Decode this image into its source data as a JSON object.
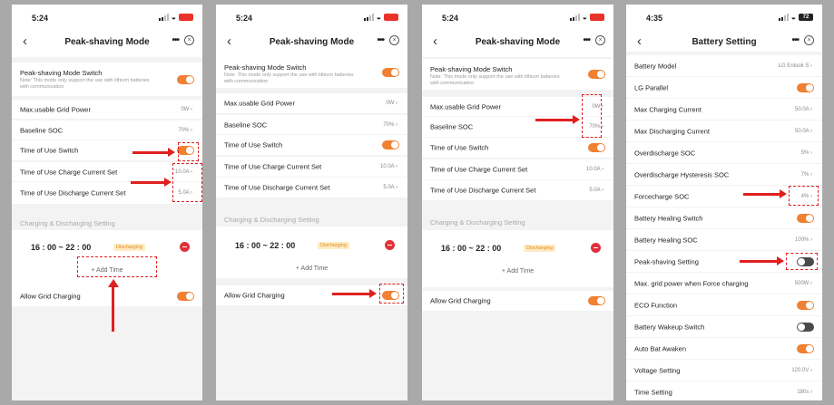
{
  "screens": [
    {
      "time": "5:24",
      "battery": "",
      "battery_color": "#e8322a",
      "title": "Peak-shaving Mode",
      "switch_label": "Peak-shaving Mode Switch",
      "switch_note": "Note: This mode only support the use with lithium batteries with communication",
      "rows": [
        {
          "label": "Max.usable Grid Power",
          "value": "0W"
        },
        {
          "label": "Baseline SOC",
          "value": "70%"
        },
        {
          "label": "Time of Use Switch",
          "value": ""
        },
        {
          "label": "Time of Use Charge Current Set",
          "value": "10.0A"
        },
        {
          "label": "Time of Use Discharge Current Set",
          "value": "5.0A"
        }
      ],
      "section": "Charging & Discharging Setting",
      "time_range": "16 : 00 ~ 22 : 00",
      "tag": "Discharging",
      "add_time": "+ Add Time",
      "allow_grid": "Allow Grid Charging"
    },
    {
      "time": "5:24",
      "battery": "",
      "battery_color": "#e8322a",
      "title": "Peak-shaving Mode",
      "switch_label": "Peak-shaving Mode Switch",
      "switch_note": "Note: This mode only support the use with lithium batteries with communication",
      "rows": [
        {
          "label": "Max.usable Grid Power",
          "value": "0W"
        },
        {
          "label": "Baseline SOC",
          "value": "70%"
        },
        {
          "label": "Time of Use Switch",
          "value": ""
        },
        {
          "label": "Time of Use Charge Current Set",
          "value": "10.0A"
        },
        {
          "label": "Time of Use Discharge Current Set",
          "value": "5.0A"
        }
      ],
      "section": "Charging & Discharging Setting",
      "time_range": "16 : 00 ~ 22 : 00",
      "tag": "Discharging",
      "add_time": "+ Add Time",
      "allow_grid": "Allow Grid Charging"
    },
    {
      "time": "5:24",
      "battery": "",
      "battery_color": "#e8322a",
      "title": "Peak-shaving Mode",
      "switch_label": "Peak-shaving Mode Switch",
      "switch_note": "Note: This mode only support the use with lithium batteries with communication",
      "rows": [
        {
          "label": "Max.usable Grid Power",
          "value": "0W"
        },
        {
          "label": "Baseline SOC",
          "value": "70%"
        },
        {
          "label": "Time of Use Switch",
          "value": ""
        },
        {
          "label": "Time of Use Charge Current Set",
          "value": "10.0A"
        },
        {
          "label": "Time of Use Discharge Current Set",
          "value": "5.0A"
        }
      ],
      "section": "Charging & Discharging Setting",
      "time_range": "16 : 00 ~ 22 : 00",
      "tag": "Discharging",
      "add_time": "+ Add Time",
      "allow_grid": "Allow Grid Charging"
    },
    {
      "time": "4:35",
      "battery": "72",
      "battery_color": "#222222",
      "title": "Battery Setting",
      "rows": [
        {
          "label": "Battery Model",
          "value": "LG Enlook S",
          "toggle": ""
        },
        {
          "label": "LG Parallel",
          "value": "",
          "toggle": "on"
        },
        {
          "label": "Max Charging Current",
          "value": "50.0A",
          "toggle": ""
        },
        {
          "label": "Max Discharging Current",
          "value": "50.0A",
          "toggle": ""
        },
        {
          "label": "Overdischarge SOC",
          "value": "5%",
          "toggle": ""
        },
        {
          "label": "Overdischarge Hysteresis SOC",
          "value": "7%",
          "toggle": ""
        },
        {
          "label": "Forcecharge SOC",
          "value": "4%",
          "toggle": ""
        },
        {
          "label": "Battery Healing Switch",
          "value": "",
          "toggle": "on"
        },
        {
          "label": "Battery Healing SOC",
          "value": "100%",
          "toggle": ""
        },
        {
          "label": "Peak-shaving Setting",
          "value": "",
          "toggle": "off"
        },
        {
          "label": "Max. grid power when Force charging",
          "value": "500W",
          "toggle": ""
        },
        {
          "label": "ECO Function",
          "value": "",
          "toggle": "on"
        },
        {
          "label": "Battery Wakeup Switch",
          "value": "",
          "toggle": "off"
        },
        {
          "label": "Auto Bat Awaken",
          "value": "",
          "toggle": "on"
        },
        {
          "label": "Voltage Setting",
          "value": "120.0V",
          "toggle": ""
        },
        {
          "label": "Time Setting",
          "value": "180s",
          "toggle": ""
        }
      ]
    }
  ],
  "colors": {
    "accent": "#f08032",
    "annotation": "#e02020",
    "danger": "#e0313a"
  }
}
